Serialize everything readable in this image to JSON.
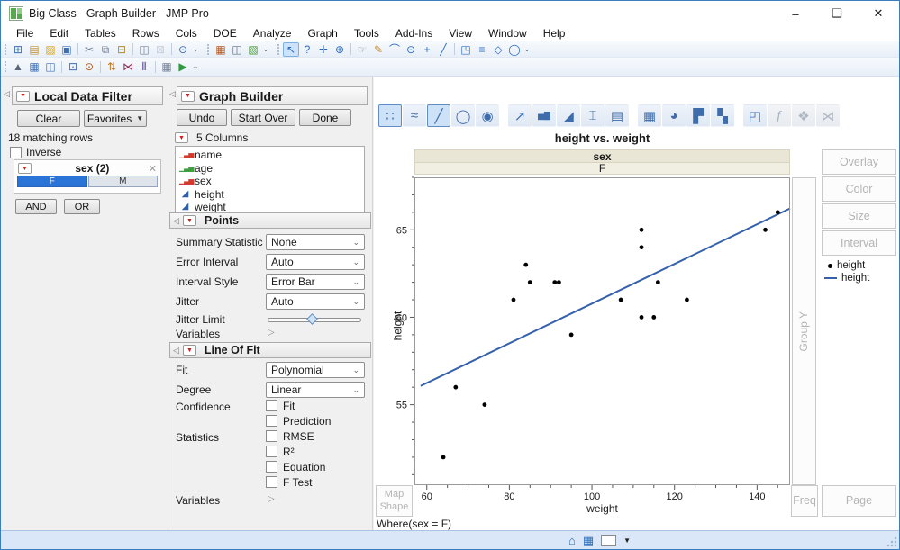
{
  "window": {
    "title": "Big Class - Graph Builder - JMP Pro",
    "controls": {
      "minimize": "–",
      "maximize": "❑",
      "close": "✕"
    }
  },
  "menubar": {
    "items": [
      "File",
      "Edit",
      "Tables",
      "Rows",
      "Cols",
      "DOE",
      "Analyze",
      "Graph",
      "Tools",
      "Add-Ins",
      "View",
      "Window",
      "Help"
    ]
  },
  "toolbar_main": {
    "groups": [
      {
        "icons": [
          {
            "name": "new-data-table-icon",
            "glyph": "⊞",
            "color": "#3d6fb4"
          },
          {
            "name": "new-journal-icon",
            "glyph": "▤",
            "color": "#c09030"
          },
          {
            "name": "open-icon",
            "glyph": "▨",
            "color": "#d8a62a"
          },
          {
            "name": "save-icon",
            "glyph": "▣",
            "color": "#3d6fb4"
          },
          {
            "sep": true
          },
          {
            "name": "cut-icon",
            "glyph": "✂",
            "color": "#76839a"
          },
          {
            "name": "copy-icon",
            "glyph": "⧉",
            "color": "#76839a"
          },
          {
            "name": "paste-icon",
            "glyph": "⊟",
            "color": "#b08a3e"
          },
          {
            "sep": true
          },
          {
            "name": "journal-layout-icon",
            "glyph": "◫",
            "color": "#76839a"
          },
          {
            "name": "lock-icon",
            "glyph": "⊠",
            "color": "#9aa4b4",
            "disabled": true
          },
          {
            "sep": true
          },
          {
            "name": "search-icon",
            "glyph": "⊙",
            "color": "#3d6fb4"
          },
          {
            "name": "toolbar-overflow-icon",
            "glyph": "⌄",
            "caret": true
          }
        ]
      },
      {
        "icons": [
          {
            "name": "data-table-icon",
            "glyph": "▦",
            "color": "#b3571f"
          },
          {
            "name": "columns-viewer-icon",
            "glyph": "◫",
            "color": "#5c6b82"
          },
          {
            "name": "new-graph-icon",
            "glyph": "▧",
            "color": "#4f9a3f"
          },
          {
            "name": "toolbar-overflow-icon",
            "glyph": "⌄",
            "caret": true
          }
        ]
      },
      {
        "icons": [
          {
            "name": "arrow-tool-icon",
            "glyph": "↖",
            "color": "#2a6bc0",
            "selected": true
          },
          {
            "name": "help-tool-icon",
            "glyph": "?",
            "color": "#2a6bc0"
          },
          {
            "name": "grabber-tool-icon",
            "glyph": "✛",
            "color": "#2a6bc0"
          },
          {
            "name": "crosshair-tool-icon",
            "glyph": "⊕",
            "color": "#2a6bc0"
          },
          {
            "sep": true
          },
          {
            "name": "hand-tool-icon",
            "glyph": "☞",
            "color": "#8a93a5"
          },
          {
            "name": "brush-tool-icon",
            "glyph": "✎",
            "color": "#c08a30"
          },
          {
            "name": "lasso-tool-icon",
            "glyph": "⌒",
            "color": "#2a6bc0"
          },
          {
            "name": "magnifier-tool-icon",
            "glyph": "⊙",
            "color": "#2a6bc0"
          },
          {
            "name": "zoom-in-tool-icon",
            "glyph": "+",
            "color": "#2a6bc0"
          },
          {
            "name": "line-annotate-icon",
            "glyph": "╱",
            "color": "#2a6bc0"
          },
          {
            "sep": true
          },
          {
            "name": "text-annotate-icon",
            "glyph": "◳",
            "color": "#2a6bc0"
          },
          {
            "name": "arrow-annotate-icon",
            "glyph": "≡",
            "color": "#2a6bc0"
          },
          {
            "name": "polygon-annotate-icon",
            "glyph": "◇",
            "color": "#2a6bc0"
          },
          {
            "name": "oval-annotate-icon",
            "glyph": "◯",
            "color": "#2a6bc0"
          },
          {
            "name": "toolbar-overflow-icon",
            "glyph": "⌄",
            "caret": true
          }
        ]
      }
    ]
  },
  "toolbar_analyze": {
    "groups": [
      {
        "icons": [
          {
            "name": "distribution-icon",
            "glyph": "▲",
            "color": "#5a6675"
          },
          {
            "name": "fit-model-icon",
            "glyph": "▦",
            "color": "#3d6fb4"
          },
          {
            "name": "tabulate-icon",
            "glyph": "◫",
            "color": "#3d6fb4"
          },
          {
            "sep": true
          },
          {
            "name": "select-report-icon",
            "glyph": "⊡",
            "color": "#3d6fb4"
          },
          {
            "name": "preview-report-icon",
            "glyph": "⊙",
            "color": "#b3571f"
          },
          {
            "sep": true
          },
          {
            "name": "sort-icon",
            "glyph": "⇅",
            "color": "#c07820"
          },
          {
            "name": "join-tables-icon",
            "glyph": "⋈",
            "color": "#8a2f4f"
          },
          {
            "name": "split-tables-icon",
            "glyph": "⫴",
            "color": "#4f3f8f"
          },
          {
            "sep": true
          },
          {
            "name": "summary-table-icon",
            "glyph": "▦",
            "color": "#76839a"
          },
          {
            "name": "run-script-icon",
            "glyph": "▶",
            "color": "#2f9a3f"
          },
          {
            "name": "toolbar-overflow-icon",
            "glyph": "⌄",
            "caret": true
          }
        ]
      }
    ]
  },
  "local_data_filter": {
    "title": "Local Data Filter",
    "clear_label": "Clear",
    "favorites_label": "Favorites",
    "matching_text": "18 matching rows",
    "inverse_label": "Inverse",
    "filter": {
      "name": "sex (2)",
      "options": [
        {
          "label": "F",
          "selected": true
        },
        {
          "label": "M",
          "selected": false
        }
      ]
    },
    "and_label": "AND",
    "or_label": "OR"
  },
  "graph_builder": {
    "title": "Graph Builder",
    "undo_label": "Undo",
    "startover_label": "Start Over",
    "done_label": "Done",
    "columns_header": "5 Columns",
    "columns": [
      {
        "label": "name",
        "type": "nominal"
      },
      {
        "label": "age",
        "type": "ordinal"
      },
      {
        "label": "sex",
        "type": "nominal"
      },
      {
        "label": "height",
        "type": "continuous"
      },
      {
        "label": "weight",
        "type": "continuous"
      }
    ],
    "points": {
      "title": "Points",
      "summary_statistic_label": "Summary Statistic",
      "summary_statistic_value": "None",
      "error_interval_label": "Error Interval",
      "error_interval_value": "Auto",
      "interval_style_label": "Interval Style",
      "interval_style_value": "Error Bar",
      "jitter_label": "Jitter",
      "jitter_value": "Auto",
      "jitter_limit_label": "Jitter Limit",
      "variables_label": "Variables"
    },
    "line_of_fit": {
      "title": "Line Of Fit",
      "fit_label": "Fit",
      "fit_value": "Polynomial",
      "degree_label": "Degree",
      "degree_value": "Linear",
      "confidence_label": "Confidence",
      "confidence_options": [
        "Fit",
        "Prediction"
      ],
      "statistics_label": "Statistics",
      "statistics_options": [
        "RMSE",
        "R²",
        "Equation",
        "F Test"
      ],
      "variables_label": "Variables"
    }
  },
  "graph": {
    "icon_strip": [
      {
        "name": "points-chart-icon",
        "glyph": "∷",
        "selected": true
      },
      {
        "name": "smoother-chart-icon",
        "glyph": "≈"
      },
      {
        "name": "line-of-fit-chart-icon",
        "glyph": "╱",
        "selected": true
      },
      {
        "name": "ellipse-chart-icon",
        "glyph": "◯"
      },
      {
        "name": "contour-chart-icon",
        "glyph": "◉"
      },
      {
        "gap": true
      },
      {
        "name": "line-chart-icon",
        "glyph": "↗"
      },
      {
        "name": "bar-chart-icon",
        "glyph": "▅▇"
      },
      {
        "name": "area-chart-icon",
        "glyph": "◢"
      },
      {
        "name": "boxplot-chart-icon",
        "glyph": "⌶"
      },
      {
        "name": "histogram-chart-icon",
        "glyph": "▤"
      },
      {
        "gap": true
      },
      {
        "name": "heatmap-chart-icon",
        "glyph": "▦"
      },
      {
        "name": "pie-chart-icon",
        "glyph": "◕"
      },
      {
        "name": "treemap-chart-icon",
        "glyph": "▛"
      },
      {
        "name": "mosaic-chart-icon",
        "glyph": "▚"
      },
      {
        "gap": true
      },
      {
        "name": "caption-box-icon",
        "glyph": "◰"
      },
      {
        "name": "formula-chart-icon",
        "glyph": "ƒ",
        "disabled": true
      },
      {
        "name": "map-shape-chart-icon",
        "glyph": "❖",
        "disabled": true
      },
      {
        "name": "parallel-chart-icon",
        "glyph": "⋈",
        "disabled": true
      }
    ],
    "group_x_label": "sex",
    "group_x_value": "F",
    "where_text": "Where(sex = F)",
    "drop_zones": {
      "overlay": "Overlay",
      "color": "Color",
      "size": "Size",
      "interval": "Interval",
      "group_y": "Group Y",
      "map_shape": "Map Shape",
      "freq": "Freq",
      "page": "Page"
    },
    "legend": [
      {
        "marker": "dot",
        "label": "height"
      },
      {
        "marker": "line",
        "label": "height"
      }
    ]
  },
  "chart_data": {
    "type": "scatter",
    "title": "height vs. weight",
    "xlabel": "weight",
    "ylabel": "height",
    "xlim": [
      57,
      148
    ],
    "ylim": [
      50.4,
      68
    ],
    "x_ticks": [
      60,
      80,
      100,
      120,
      140
    ],
    "x_minor_step": 5,
    "y_ticks": [
      55,
      60,
      65
    ],
    "y_minor_step": 1,
    "grid": false,
    "points_xy": [
      [
        95,
        59
      ],
      [
        123,
        61
      ],
      [
        74,
        55
      ],
      [
        145,
        66
      ],
      [
        64,
        52
      ],
      [
        112,
        60
      ],
      [
        107,
        61
      ],
      [
        67,
        56
      ],
      [
        81,
        61
      ],
      [
        91,
        62
      ],
      [
        142,
        65
      ],
      [
        84,
        63
      ],
      [
        85,
        62
      ],
      [
        92,
        62
      ],
      [
        112,
        64
      ],
      [
        112,
        65
      ],
      [
        115,
        60
      ],
      [
        116,
        62
      ]
    ],
    "fit_line": {
      "type": "linear",
      "slope": 0.1134,
      "intercept": 49.44,
      "x_start": 58.5,
      "x_end": 148
    },
    "point_color": "#000000",
    "line_color": "#3560ac",
    "legend_position": "right"
  },
  "colors": {
    "accent_blue": "#2a74d8",
    "band_beige": "#e9e6d6",
    "fit_line": "#3560ac",
    "selected_icon_bg": "#cde1f7"
  }
}
